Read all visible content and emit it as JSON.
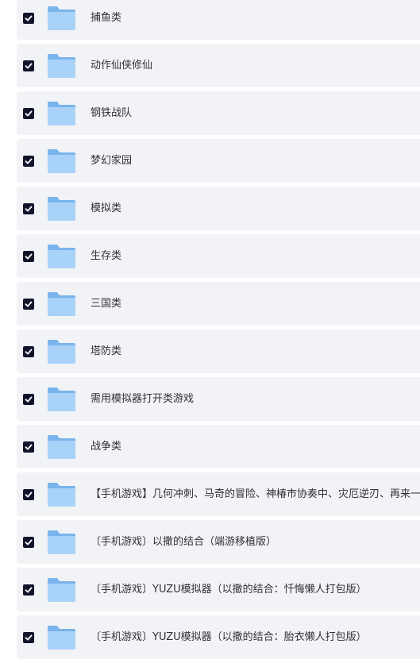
{
  "items": [
    {
      "label": "捕鱼类",
      "checked": true,
      "icon": "folder-icon"
    },
    {
      "label": "动作仙侠修仙",
      "checked": true,
      "icon": "folder-icon"
    },
    {
      "label": "钢铁战队",
      "checked": true,
      "icon": "folder-icon"
    },
    {
      "label": "梦幻家园",
      "checked": true,
      "icon": "folder-icon"
    },
    {
      "label": "模拟类",
      "checked": true,
      "icon": "folder-icon"
    },
    {
      "label": "生存类",
      "checked": true,
      "icon": "folder-icon"
    },
    {
      "label": "三国类",
      "checked": true,
      "icon": "folder-icon"
    },
    {
      "label": "塔防类",
      "checked": true,
      "icon": "folder-icon"
    },
    {
      "label": "需用模拟器打开类游戏",
      "checked": true,
      "icon": "folder-icon"
    },
    {
      "label": "战争类",
      "checked": true,
      "icon": "folder-icon"
    },
    {
      "label": "【手机游戏】几何冲刺、马奇的冒险、神椿市协奏中、灾厄逆刃、再来一",
      "checked": true,
      "icon": "folder-icon"
    },
    {
      "label": "〔手机游戏〕以撒的结合（端游移植版）",
      "checked": true,
      "icon": "folder-icon"
    },
    {
      "label": "〔手机游戏〕YUZU模拟器（以撒的结合：忏悔懒人打包版）",
      "checked": true,
      "icon": "folder-icon"
    },
    {
      "label": "〔手机游戏〕YUZU模拟器（以撒的结合：胎衣懒人打包版）",
      "checked": true,
      "icon": "folder-icon"
    }
  ],
  "colors": {
    "row_bg": "#f2f3f6",
    "checkbox": "#12142b",
    "folder_back": "#7ab4ec",
    "folder_front": "#a9d2f8"
  }
}
